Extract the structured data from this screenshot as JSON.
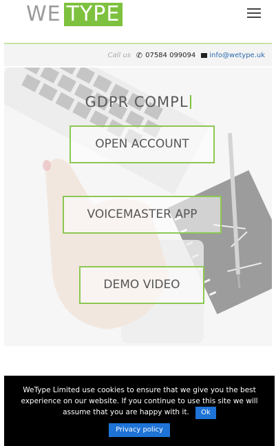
{
  "header": {
    "logo_we": "WE",
    "logo_type": "TYPE"
  },
  "contact": {
    "call_label": "Call us",
    "phone": "07584 099094",
    "email": "info@wetype.uk"
  },
  "hero": {
    "title": "GDPR COMPL",
    "buttons": {
      "open_account": "OPEN ACCOUNT",
      "voicemaster": "VOICEMASTER APP",
      "demo_video": "DEMO VIDEO"
    }
  },
  "cookie": {
    "message": "WeType Limited use cookies to ensure that we give you the best experience on our website. If you continue to use this site we will assume that you are happy with it.",
    "ok_label": "Ok",
    "privacy_label": "Privacy policy"
  },
  "colors": {
    "brand_green": "#7ec13f",
    "button_border": "#8cc751",
    "link_blue": "#2a6ab0",
    "cookie_button": "#1e73d6"
  }
}
